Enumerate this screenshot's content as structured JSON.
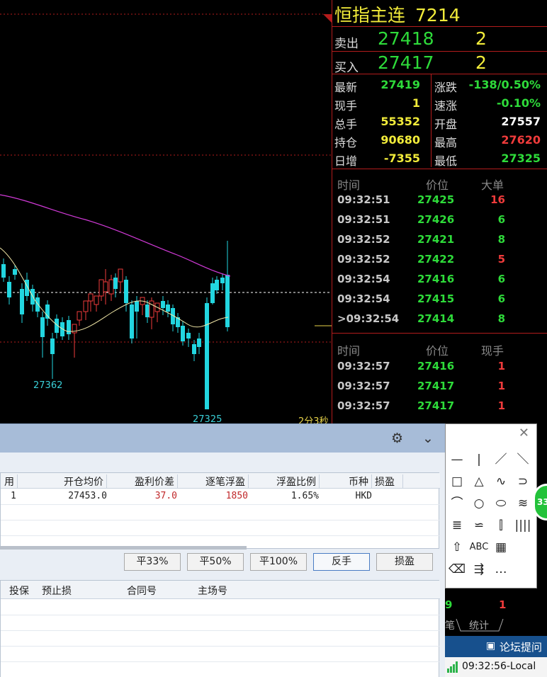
{
  "quote": {
    "title": "恒指主连",
    "code": "7214",
    "sell_label": "卖出",
    "sell_price": "27418",
    "sell_qty": "2",
    "buy_label": "买入",
    "buy_price": "27417",
    "buy_qty": "2",
    "stats": [
      {
        "l1": "最新",
        "v1": "27419",
        "c1": "#2edb3a",
        "l2": "涨跌",
        "v2": "-138/0.50%",
        "c2": "#2edb3a"
      },
      {
        "l1": "现手",
        "v1": "1",
        "c1": "#f2ec3a",
        "l2": "速涨",
        "v2": "-0.10%",
        "c2": "#2edb3a"
      },
      {
        "l1": "总手",
        "v1": "55352",
        "c1": "#f2ec3a",
        "l2": "开盘",
        "v2": "27557",
        "c2": "#ffffff"
      },
      {
        "l1": "持仓",
        "v1": "90680",
        "c1": "#f2ec3a",
        "l2": "最高",
        "v2": "27620",
        "c2": "#f03b3b"
      },
      {
        "l1": "日增",
        "v1": "-7355",
        "c1": "#f2ec3a",
        "l2": "最低",
        "v2": "27325",
        "c2": "#2edb3a"
      }
    ],
    "tick1_headers": [
      "时间",
      "价位",
      "大单"
    ],
    "tick1_rows": [
      {
        "time": "09:32:51",
        "price": "27425",
        "qty": "16",
        "qc": "#f03b3b"
      },
      {
        "time": "09:32:51",
        "price": "27426",
        "qty": "6",
        "qc": "#2edb3a"
      },
      {
        "time": "09:32:52",
        "price": "27421",
        "qty": "8",
        "qc": "#2edb3a"
      },
      {
        "time": "09:32:52",
        "price": "27422",
        "qty": "5",
        "qc": "#f03b3b"
      },
      {
        "time": "09:32:54",
        "price": "27416",
        "qty": "6",
        "qc": "#2edb3a"
      },
      {
        "time": "09:32:54",
        "price": "27415",
        "qty": "6",
        "qc": "#2edb3a"
      },
      {
        "time": ">09:32:54",
        "price": "27414",
        "qty": "8",
        "qc": "#2edb3a"
      }
    ],
    "tick2_headers": [
      "时间",
      "价位",
      "现手"
    ],
    "tick2_rows": [
      {
        "time": "09:32:57",
        "price": "27416",
        "qty": "1",
        "qc": "#f03b3b"
      },
      {
        "time": "09:32:57",
        "price": "27417",
        "qty": "1",
        "qc": "#f03b3b"
      },
      {
        "time": "09:32:57",
        "price": "27417",
        "qty": "1",
        "qc": "#f03b3b"
      }
    ]
  },
  "chart": {
    "low1": "27362",
    "low2": "27325",
    "countdown": "2分3秒",
    "colors": {
      "up": "#f03b3b",
      "down": "#22d6e0",
      "ma_long": "#d23ad8",
      "ma_short": "#f2e8a8"
    }
  },
  "order": {
    "headers": [
      "用",
      "开仓均价",
      "盈利价差",
      "逐笔浮盈",
      "浮盈比例",
      "币种",
      "损盈"
    ],
    "row": [
      "1",
      "27453.0",
      "37.0",
      "1850",
      "1.65%",
      "HKD",
      ""
    ],
    "buttons": [
      "平33%",
      "平50%",
      "平100%",
      "反手",
      "损盈"
    ],
    "headers2": [
      "投保",
      "预止损",
      "合同号",
      "主场号"
    ]
  },
  "tools": {
    "close": "✕",
    "items": [
      "—",
      "|",
      "／",
      "＼",
      "□",
      "△",
      "∿",
      "⊃",
      "⌒",
      "○",
      "⬭",
      "≋",
      "≣",
      "⋍",
      "⫿",
      "||||",
      "⇧",
      "ABC",
      "▦",
      "",
      "⌫",
      "⇶",
      "…",
      ""
    ]
  },
  "badge": "33",
  "lower": {
    "val_green": "9",
    "val_red": "1",
    "tab1": "笔",
    "tab2": "统计"
  },
  "forum": "论坛提问",
  "status": "09:32:56-Local"
}
